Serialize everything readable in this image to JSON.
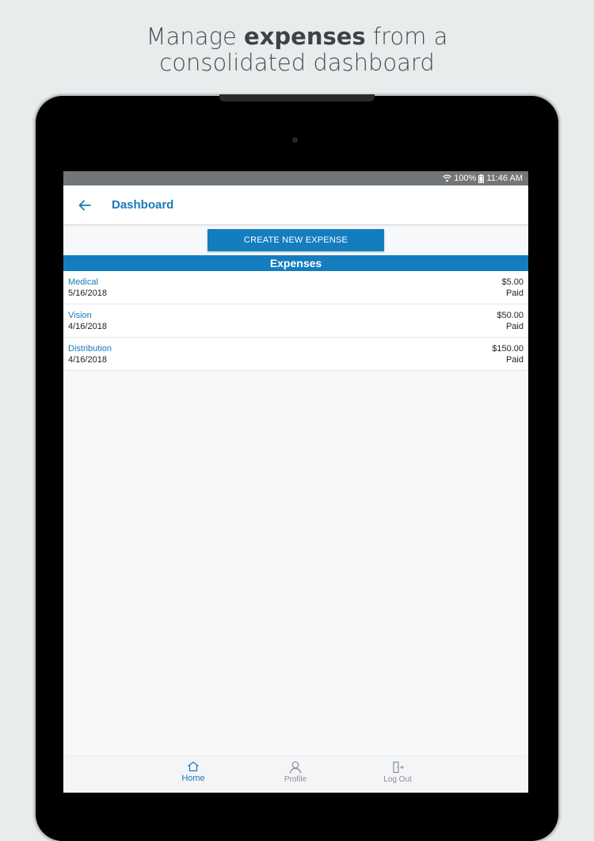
{
  "headline": {
    "prefix": "Manage ",
    "bold": "expenses",
    "suffix": " from a",
    "line2": "consolidated dashboard"
  },
  "statusbar": {
    "battery": "100%",
    "time": "11:46 AM"
  },
  "appbar": {
    "back_icon": "arrow-left-icon",
    "title": "Dashboard"
  },
  "create_button": {
    "label": "CREATE NEW EXPENSE"
  },
  "section": {
    "title": "Expenses"
  },
  "expenses": [
    {
      "category": "Medical",
      "date": "5/16/2018",
      "amount": "$5.00",
      "status": "Paid"
    },
    {
      "category": "Vision",
      "date": "4/16/2018",
      "amount": "$50.00",
      "status": "Paid"
    },
    {
      "category": "Distribution",
      "date": "4/16/2018",
      "amount": "$150.00",
      "status": "Paid"
    }
  ],
  "bottom_nav": [
    {
      "label": "Home",
      "icon": "home-icon",
      "active": true
    },
    {
      "label": "Profile",
      "icon": "profile-icon",
      "active": false
    },
    {
      "label": "Log Out",
      "icon": "logout-icon",
      "active": false
    }
  ],
  "colors": {
    "accent": "#147dbf",
    "link": "#1a7ab8",
    "background": "#e9ecec"
  }
}
